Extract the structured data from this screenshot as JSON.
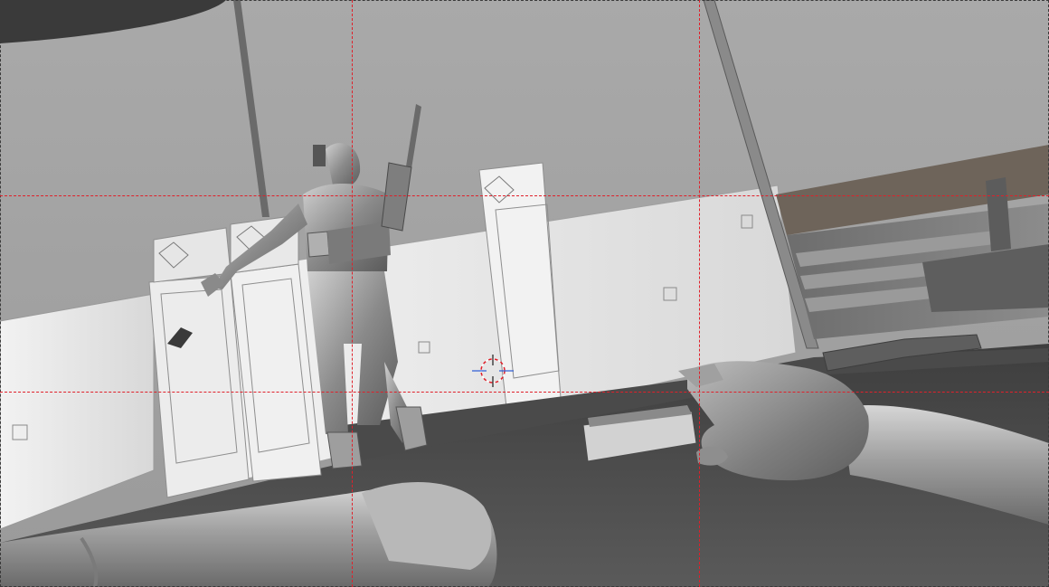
{
  "viewport": {
    "mode": "solid-shaded-3d-viewport",
    "overlay": "rule-of-thirds-guides",
    "guide_color": "#e0202a",
    "background_color": "#8a8a8a",
    "icons": {
      "cursor": "3d-cursor-icon",
      "pistol": "pistol-icon",
      "rifle": "rifle-icon"
    }
  }
}
